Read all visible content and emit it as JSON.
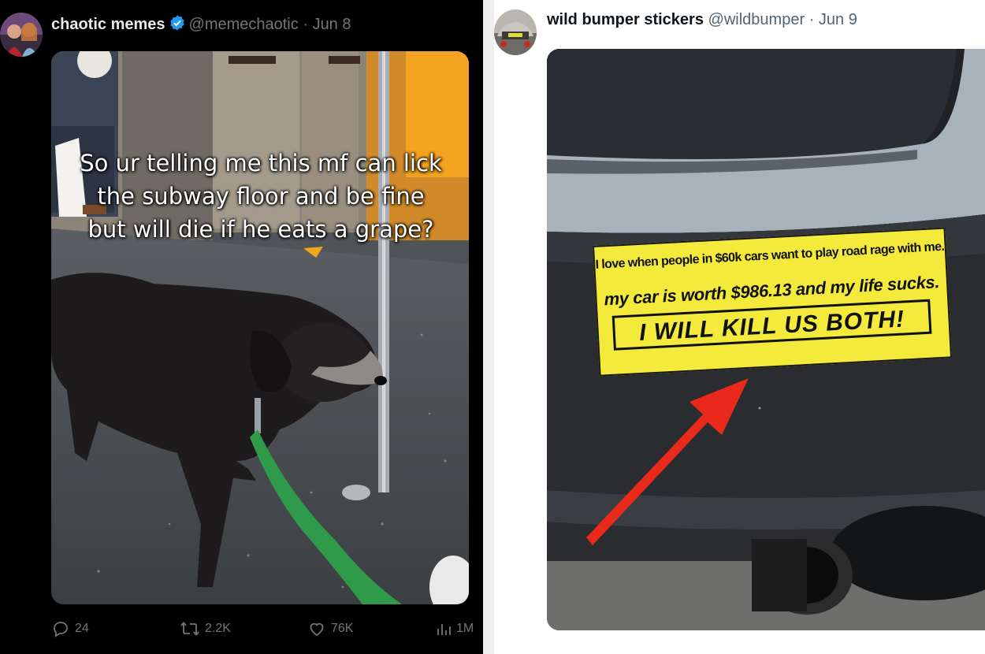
{
  "left_post": {
    "display_name": "chaotic memes",
    "handle": "@memechaotic",
    "separator": "·",
    "date": "Jun 8",
    "verified": true,
    "media_text_lines": [
      "So ur telling me this mf can lick",
      "the subway floor and be fine",
      "but will die if he eats a grape?"
    ],
    "actions": {
      "replies": "24",
      "reposts": "2.2K",
      "likes": "76K",
      "views": "1M"
    }
  },
  "right_post": {
    "display_name": "wild bumper stickers",
    "handle": "@wildbumper",
    "separator": "·",
    "date": "Jun 9",
    "sticker": {
      "line1": "I love when people in $60k cars want to play road rage with me.",
      "line2": "my car is worth $986.13 and my life sucks.",
      "line3": "I WILL KILL US BOTH!"
    }
  },
  "colors": {
    "left_bg": "#000000",
    "right_bg": "#ffffff",
    "verified_blue": "#1d9bf0",
    "sticker_yellow": "#f3ea3b",
    "arrow_red": "#e8291c",
    "leash_green": "#2e9a4a"
  },
  "icons": [
    "verified-badge-icon",
    "reply-icon",
    "repost-icon",
    "like-icon",
    "views-icon"
  ]
}
